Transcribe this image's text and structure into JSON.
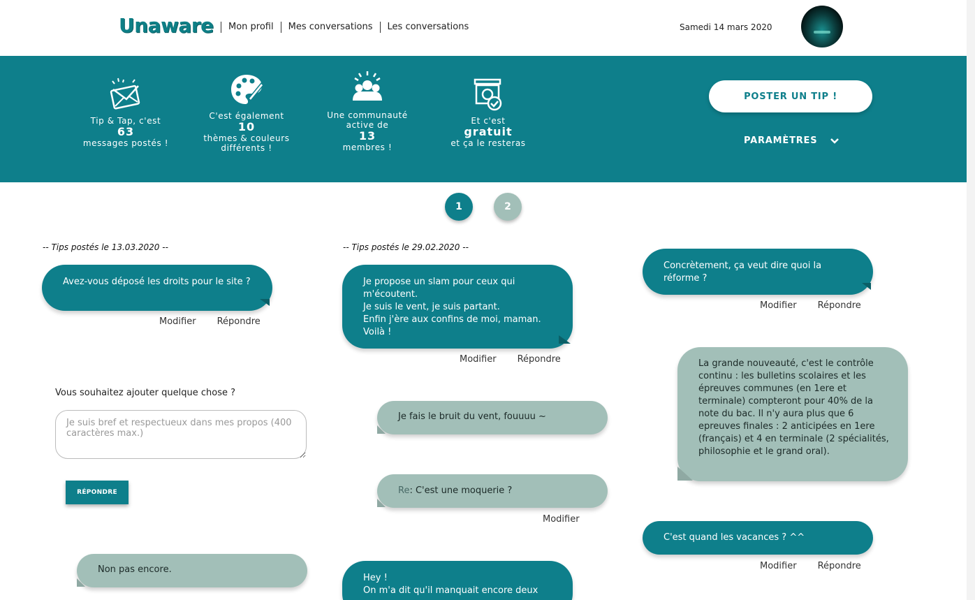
{
  "header": {
    "logo": "Unaware",
    "nav": [
      "Mon profil",
      "Mes conversations",
      "Les conversations"
    ],
    "date": "Samedi 14 mars 2020"
  },
  "stats": [
    {
      "icon": "envelope-icon",
      "l1": "Tip & Tap, c'est",
      "num": "63",
      "l3": "messages postés !"
    },
    {
      "icon": "palette-icon",
      "l1": "C'est également",
      "num": "10",
      "l3": "thèmes & couleurs différents !"
    },
    {
      "icon": "community-icon",
      "l1": "Une communauté active de",
      "num": "13",
      "l3": "membres !"
    },
    {
      "icon": "free-icon",
      "l1": "Et c'est",
      "num": "gratuit",
      "l3": "et ça le resteras"
    }
  ],
  "actions_panel": {
    "post_label": "POSTER UN TIP !",
    "params_label": "PARAMÈTRES"
  },
  "pagination": [
    "1",
    "2"
  ],
  "colors": {
    "teal": "#0e7f8b",
    "grey_bubble": "#a2bfb8",
    "page_inactive": "#a2bfb8"
  },
  "col1": {
    "day": "-- Tips postés le 13.03.2020 --",
    "tip1": "Avez-vous déposé les droits pour le site ?",
    "ask": "Vous souhaitez ajouter quelque chose ?",
    "placeholder": "Je suis bref et respectueux dans mes propos (400 caractères max.)",
    "reply_button": "RÉPONDRE",
    "reply1": "Non pas encore."
  },
  "col2": {
    "day": "-- Tips postés le 29.02.2020 --",
    "tip1": "Je propose un slam pour ceux qui m'écoutent.\nJe suis le vent, je suis partant.\nEnfin j'ère aux confins de moi, maman.\nVoilà !",
    "reply1": "Je fais le bruit du vent, fouuuu ~",
    "reply2_prefix": "Re",
    "reply2_text": ": C'est une moquerie ?",
    "tip2": "Hey !\nOn m'a dit qu'il manquait encore deux"
  },
  "col3": {
    "tip1": "Concrètement, ça veut dire quoi la réforme ?",
    "reply1": "La grande nouveauté, c'est le contrôle continu : les bulletins scolaires et les épreuves communes (en 1ere et terminale) compteront pour 40% de la note du bac. Il n'y aura plus que 6 epreuves finales : 2 anticipées en 1ere (français) et 4 en terminale (2 spécialités, philosophie et le grand oral).",
    "tip2": "C'est quand les vacances ? ^^"
  },
  "labels": {
    "modify": "Modifier",
    "reply": "Répondre"
  }
}
